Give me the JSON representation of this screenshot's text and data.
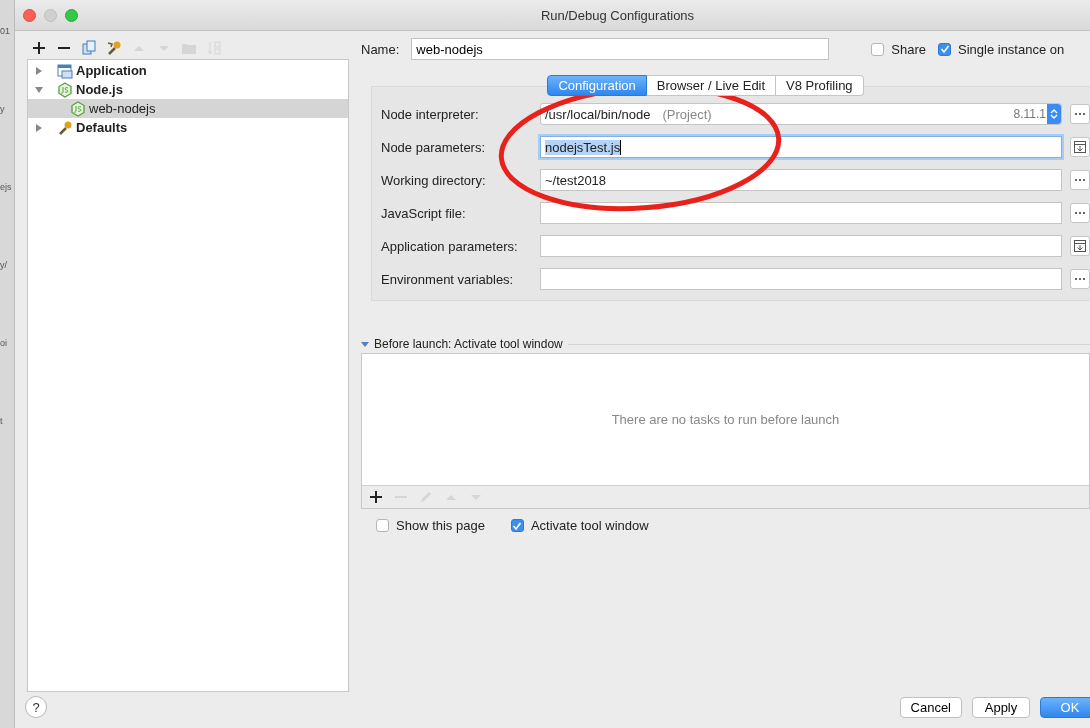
{
  "backdrop": {
    "fragments": [
      "01",
      "y",
      "ejs",
      "y/",
      "oi",
      "t"
    ]
  },
  "window": {
    "title": "Run/Debug Configurations"
  },
  "toolbar": [
    {
      "kind": "add",
      "disabled": false
    },
    {
      "kind": "remove",
      "disabled": false
    },
    {
      "kind": "copy",
      "disabled": false
    },
    {
      "kind": "wrench",
      "disabled": false
    },
    {
      "kind": "up",
      "disabled": true
    },
    {
      "kind": "down",
      "disabled": true
    },
    {
      "kind": "folder",
      "disabled": true
    },
    {
      "kind": "sort",
      "disabled": true
    }
  ],
  "tree": [
    {
      "label": "Application",
      "kind": "application",
      "expanded": false,
      "selected": false
    },
    {
      "label": "Node.js",
      "kind": "nodejs",
      "expanded": true,
      "selected": false,
      "children": [
        {
          "label": "web-nodejs",
          "kind": "nodejs",
          "selected": false,
          "current": true
        }
      ]
    },
    {
      "label": "Defaults",
      "kind": "defaults",
      "expanded": false,
      "selected": false
    }
  ],
  "name_field": {
    "label": "Name:",
    "value": "web-nodejs"
  },
  "options": [
    {
      "label": "Share",
      "checked": false
    },
    {
      "label": "Single instance on",
      "checked": true
    }
  ],
  "tabs": [
    {
      "label": "Configuration",
      "selected": true
    },
    {
      "label": "Browser / Live Edit",
      "selected": false
    },
    {
      "label": "V8 Profiling",
      "selected": false
    }
  ],
  "fields": [
    {
      "label": "Node interpreter:",
      "kind": "dropdown",
      "value": "/usr/local/bin/node",
      "hint": "(Project)",
      "version": "8.11.1",
      "button": {
        "kind": "browse"
      },
      "focused": false
    },
    {
      "label": "Node parameters:",
      "kind": "text",
      "value": "nodejsTest.js",
      "button": {
        "kind": "expand"
      },
      "focused": true
    },
    {
      "label": "Working directory:",
      "kind": "text",
      "value": "~/test2018",
      "button": {
        "kind": "browse"
      },
      "focused": false
    },
    {
      "label": "JavaScript file:",
      "kind": "text",
      "button": {
        "kind": "browse"
      },
      "focused": false
    },
    {
      "label": "Application parameters:",
      "kind": "text",
      "button": {
        "kind": "expand"
      },
      "focused": false
    },
    {
      "label": "Environment variables:",
      "kind": "text",
      "button": {
        "kind": "browse"
      },
      "focused": false
    }
  ],
  "before_launch": {
    "title": "Before launch: Activate tool window",
    "expanded": true,
    "empty_text": "There are no tasks to run before launch",
    "toolbar": [
      {
        "kind": "add",
        "disabled": false
      },
      {
        "kind": "remove",
        "disabled": true
      },
      {
        "kind": "edit",
        "disabled": true
      },
      {
        "kind": "up",
        "disabled": true
      },
      {
        "kind": "down",
        "disabled": true
      }
    ]
  },
  "launch_options": [
    {
      "label": "Show this page",
      "checked": false
    },
    {
      "label": "Activate tool window",
      "checked": true
    }
  ],
  "help": {
    "label": "?"
  },
  "buttons": [
    {
      "label": "Cancel",
      "default": false
    },
    {
      "label": "Apply",
      "default": false
    },
    {
      "label": "OK",
      "default": true
    }
  ]
}
